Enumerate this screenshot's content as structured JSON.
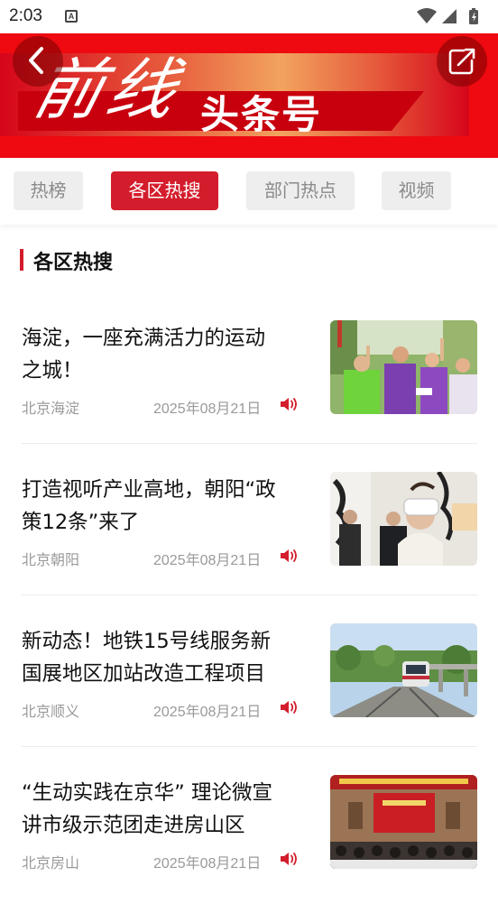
{
  "status_bar": {
    "time": "2:03",
    "notification_icon": "A",
    "icons": [
      "wifi-icon",
      "signal-icon",
      "battery-icon"
    ]
  },
  "banner": {
    "calligraphy": "前线",
    "title": "头条号",
    "back_icon": "chevron-left-icon",
    "share_icon": "share-icon"
  },
  "tabs": [
    {
      "label": "热榜",
      "active": false
    },
    {
      "label": "各区热搜",
      "active": true
    },
    {
      "label": "部门热点",
      "active": false
    },
    {
      "label": "视频",
      "active": false
    }
  ],
  "section": {
    "title": "各区热搜"
  },
  "news": [
    {
      "title_line1": "海淀，一座充满活力的运动",
      "title_line2": "之城！",
      "source": "北京海淀",
      "date": "2025年08月21日",
      "audio_icon": "speaker-icon",
      "image_subject": "runners-crowd"
    },
    {
      "title_line1": "打造视听产业高地，朝阳“政",
      "title_line2": "策12条”来了",
      "source": "北京朝阳",
      "date": "2025年08月21日",
      "audio_icon": "speaker-icon",
      "image_subject": "vr-headset-woman"
    },
    {
      "title_line1": "新动态！地铁15号线服务新",
      "title_line2": "国展地区加站改造工程项目",
      "source": "北京顺义",
      "date": "2025年08月21日",
      "audio_icon": "speaker-icon",
      "image_subject": "subway-train"
    },
    {
      "title_line1": "“生动实践在京华” 理论微宣",
      "title_line2": "讲市级示范团走进房山区",
      "source": "北京房山",
      "date": "2025年08月21日",
      "audio_icon": "speaker-icon",
      "image_subject": "conference-stage"
    }
  ],
  "colors": {
    "accent": "#d41d2c",
    "banner_red": "#ee0a10",
    "muted_text": "#9a9a9a",
    "tab_bg": "#eeeeee"
  }
}
